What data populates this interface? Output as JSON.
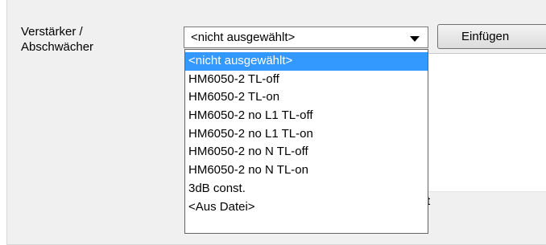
{
  "field": {
    "label": "Verstärker /\nAbschwächer"
  },
  "combo": {
    "selected": "<nicht ausgewählt>",
    "arrow_icon": "chevron-down-icon"
  },
  "insert_button": {
    "label": "Einfügen"
  },
  "dropdown": {
    "items": [
      "<nicht ausgewählt>",
      "HM6050-2 TL-off",
      "HM6050-2 TL-on",
      "HM6050-2 no L1 TL-off",
      "HM6050-2 no L1 TL-on",
      "HM6050-2 no N TL-off",
      "HM6050-2 no N TL-on",
      "3dB const.",
      "<Aus Datei>"
    ],
    "highlighted_index": 0,
    "highlight_color": "#3399ff"
  },
  "partial_text": "t"
}
